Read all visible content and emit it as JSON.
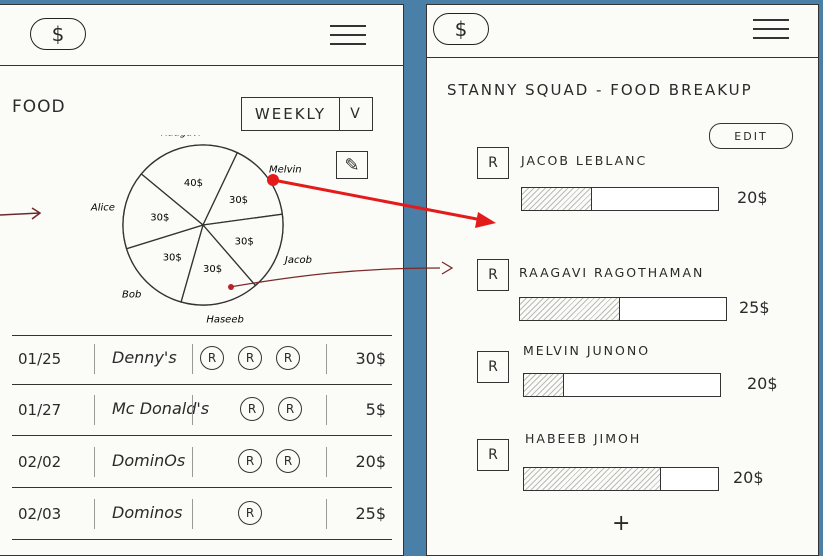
{
  "left": {
    "header": {
      "currency_icon": "$"
    },
    "category_title": "FOOD",
    "period_select": {
      "value": "WEEKLY",
      "caret": "V"
    },
    "edit_icon": "pencil-icon",
    "chart_data": {
      "type": "pie",
      "categories": [
        "Raagavi",
        "Melvin",
        "Jacob",
        "Haseeb",
        "Bob",
        "Alice"
      ],
      "values": [
        40,
        30,
        30,
        30,
        30,
        30
      ],
      "labels": [
        "40$",
        "30$",
        "30$",
        "30$",
        "30$",
        "30$"
      ]
    },
    "transactions": [
      {
        "date": "01/25",
        "place": "Denny's",
        "avatars": [
          "R",
          "R",
          "R"
        ],
        "amount": "30$"
      },
      {
        "date": "01/27",
        "place": "Mc Donald's",
        "avatars": [
          "R",
          "R"
        ],
        "amount": "5$"
      },
      {
        "date": "02/02",
        "place": "DominOs",
        "avatars": [
          "R",
          "R"
        ],
        "amount": "20$"
      },
      {
        "date": "02/03",
        "place": "Dominos",
        "avatars": [
          "R"
        ],
        "amount": "25$"
      }
    ]
  },
  "right": {
    "header": {
      "currency_icon": "$"
    },
    "title": "STANNY SQUAD - FOOD BREAKUP",
    "edit_label": "EDIT",
    "members": [
      {
        "name": "JACOB LEBLANC",
        "avatar": "R",
        "amount": "20$",
        "share": 0.35
      },
      {
        "name": "RAAGAVI RAGOTHAMAN",
        "avatar": "R",
        "amount": "25$",
        "share": 0.48
      },
      {
        "name": "MELVIN JUNONO",
        "avatar": "R",
        "amount": "20$",
        "share": 0.2
      },
      {
        "name": "HABEEB JIMOH",
        "avatar": "R",
        "amount": "20$",
        "share": 0.7
      }
    ],
    "add_label": "+"
  },
  "colors": {
    "annotation": "#e31b1b",
    "ink": "#2a2a2a",
    "background": "#4a7fa8"
  }
}
